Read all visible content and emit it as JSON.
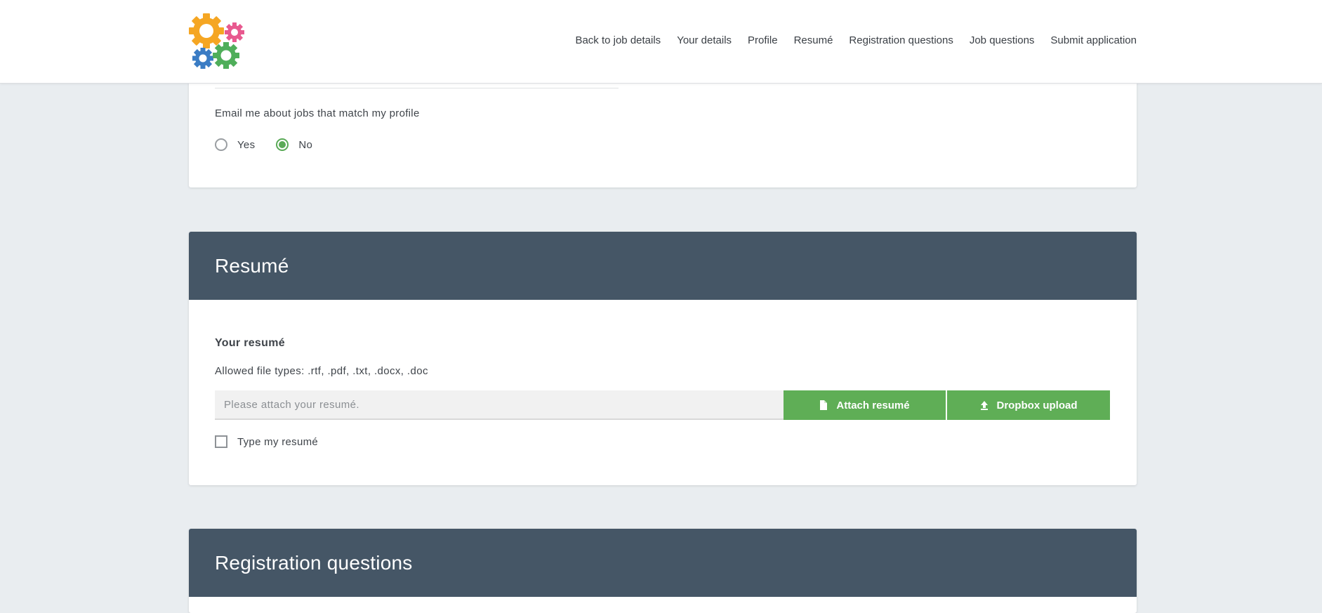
{
  "header": {
    "logo": "gears-logo",
    "nav": [
      {
        "label": "Back to job details"
      },
      {
        "label": "Your details"
      },
      {
        "label": "Profile"
      },
      {
        "label": "Resumé"
      },
      {
        "label": "Registration questions"
      },
      {
        "label": "Job questions"
      },
      {
        "label": "Submit application"
      }
    ]
  },
  "profile_section": {
    "email_question": "Email me about jobs that match my profile",
    "options": [
      {
        "label": "Yes",
        "selected": false
      },
      {
        "label": "No",
        "selected": true
      }
    ]
  },
  "resume_section": {
    "title": "Resumé",
    "subtitle": "Your resumé",
    "allowed_types": "Allowed file types: .rtf, .pdf, .txt, .docx, .doc",
    "file_placeholder": "Please attach your resumé.",
    "attach_button": "Attach resumé",
    "dropbox_button": "Dropbox upload",
    "type_checkbox_label": "Type my resumé",
    "type_checkbox_checked": false
  },
  "registration_section": {
    "title": "Registration questions"
  },
  "colors": {
    "accent_green": "#5fae56",
    "section_header": "#455666",
    "page_bg": "#e9edf0"
  }
}
